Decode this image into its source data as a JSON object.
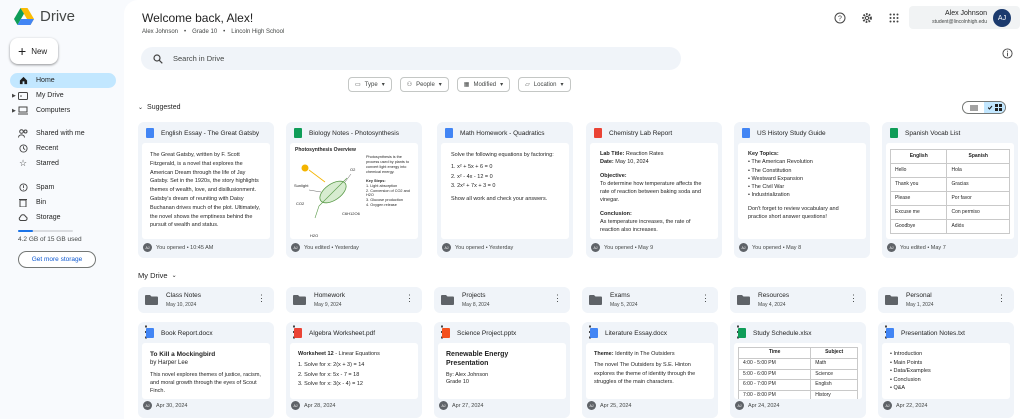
{
  "app": {
    "name": "Drive"
  },
  "nav": {
    "new_label": "New",
    "items": [
      {
        "label": "Home"
      },
      {
        "label": "My Drive"
      },
      {
        "label": "Computers"
      },
      {
        "label": "Shared with me"
      },
      {
        "label": "Recent"
      },
      {
        "label": "Starred"
      },
      {
        "label": "Spam"
      },
      {
        "label": "Bin"
      },
      {
        "label": "Storage"
      }
    ],
    "storage_text": "4.2 GB of 15 GB used",
    "storage_fraction": 0.28,
    "get_storage_label": "Get more storage"
  },
  "header": {
    "welcome": "Welcome back, Alex!",
    "sub": [
      "Alex Johnson",
      "Grade 10",
      "Lincoln High School"
    ],
    "account_name": "Alex Johnson",
    "account_email": "student@lincolnhigh.edu",
    "avatar_initials": "AJ"
  },
  "search": {
    "placeholder": "Search in Drive"
  },
  "filters": [
    "Type",
    "People",
    "Modified",
    "Location"
  ],
  "suggested": {
    "title": "Suggested",
    "cards": [
      {
        "title": "English Essay - The Great Gatsby",
        "footer": "You opened • 10:45 AM",
        "text": "The Great Gatsby, written by F. Scott Fitzgerald, is a novel that explores the American Dream through the life of Jay Gatsby. Set in the 1920s, the story highlights themes of wealth, love, and disillusionment. Gatsby's dream of reuniting with Daisy Buchanan drives much of the plot. Ultimately, the novel shows the emptiness behind the pursuit of wealth and status."
      },
      {
        "title": "Biology Notes - Photosynthesis",
        "footer": "You edited • Yesterday",
        "heading": "Photosynthesis Overview",
        "desc": "Photosynthesis is the process used by plants to convert light energy into chemical energy.",
        "labels": [
          "Sunlight",
          "O2",
          "CO2",
          "C6H12O6",
          "H2O"
        ],
        "steps_title": "Key Steps:",
        "steps": [
          "1. Light absorption",
          "2. Conversion of CO2 and H2O",
          "3. Glucose production",
          "4. Oxygen release"
        ]
      },
      {
        "title": "Math Homework - Quadratics",
        "footer": "You opened • Yesterday",
        "intro": "Solve the following equations by factoring:",
        "items": [
          "1.  x² + 5x + 6 = 0",
          "2.  x² - 4x - 12 = 0",
          "3.  2x² + 7x + 3 = 0"
        ],
        "outro": "Show all work and check your answers."
      },
      {
        "title": "Chemistry Lab Report",
        "footer": "You opened • May 9",
        "lines": [
          {
            "label": "Lab Title:",
            "value": " Reaction Rates"
          },
          {
            "label": "Date:",
            "value": " May 10, 2024"
          }
        ],
        "objective_label": "Objective:",
        "objective": "To determine how temperature affects the rate of reaction between baking soda and vinegar.",
        "conclusion_label": "Conclusion:",
        "conclusion": "As temperature increases, the rate of reaction also increases."
      },
      {
        "title": "US History Study Guide",
        "footer": "You opened • May 8",
        "topics_label": "Key Topics:",
        "topics": [
          "The American Revolution",
          "The Constitution",
          "Westward Expansion",
          "The Civil War",
          "Industrialization"
        ],
        "note": "Don't forget to review vocabulary and practice short answer questions!"
      },
      {
        "title": "Spanish Vocab List",
        "footer": "You edited • May 7",
        "headers": [
          "English",
          "Spanish"
        ],
        "rows": [
          [
            "Hello",
            "Hola"
          ],
          [
            "Thank you",
            "Gracias"
          ],
          [
            "Please",
            "Por favor"
          ],
          [
            "Excuse me",
            "Con permiso"
          ],
          [
            "Goodbye",
            "Adiós"
          ]
        ]
      }
    ]
  },
  "mydrive": {
    "title": "My Drive",
    "folders": [
      {
        "name": "Class Notes",
        "date": "May 10, 2024"
      },
      {
        "name": "Homework",
        "date": "May 9, 2024"
      },
      {
        "name": "Projects",
        "date": "May 8, 2024"
      },
      {
        "name": "Exams",
        "date": "May 5, 2024"
      },
      {
        "name": "Resources",
        "date": "May 4, 2024"
      },
      {
        "name": "Personal",
        "date": "May 1, 2024"
      }
    ],
    "files": [
      {
        "title": "Book Report.docx",
        "date": "Apr 30, 2024",
        "heading": "To Kill a Mockingbird",
        "sub": "by Harper Lee",
        "body": "This novel explores themes of justice, racism, and moral growth through the eyes of Scout Finch."
      },
      {
        "title": "Algebra Worksheet.pdf",
        "date": "Apr 28, 2024",
        "heading": "Worksheet 12",
        "heading2": " - Linear Equations",
        "items": [
          "1.  Solve for x: 2(x + 3) = 14",
          "2.  Solve for x: 5x - 7 = 18",
          "3.  Solve for x: 3(x - 4) = 12"
        ]
      },
      {
        "title": "Science Project.pptx",
        "date": "Apr 27, 2024",
        "heading": "Renewable Energy Presentation",
        "lines": [
          "By: Alex Johnson",
          "Grade 10"
        ]
      },
      {
        "title": "Literature Essay.docx",
        "date": "Apr 25, 2024",
        "theme_label": "Theme:",
        "theme": " Identity in The Outsiders",
        "body": "The novel The Outsiders by S.E. Hinton explores the theme of identity through the struggles of the main characters."
      },
      {
        "title": "Study Schedule.xlsx",
        "date": "Apr 24, 2024",
        "headers": [
          "Time",
          "Subject"
        ],
        "rows": [
          [
            "4:00 - 5:00 PM",
            "Math"
          ],
          [
            "5:00 - 6:00 PM",
            "Science"
          ],
          [
            "6:00 - 7:00 PM",
            "English"
          ],
          [
            "7:00 - 8:00 PM",
            "History"
          ]
        ]
      },
      {
        "title": "Presentation Notes.txt",
        "date": "Apr 22, 2024",
        "items": [
          "Introduction",
          "Main Points",
          "Data/Examples",
          "Conclusion",
          "Q&A"
        ]
      }
    ]
  },
  "colors": {
    "doc": "#4285f4",
    "sheet": "#0f9d58",
    "pdf": "#ea4335",
    "slide": "#f4b400",
    "active": "#c2e7ff",
    "accent": "#0b57d0"
  }
}
